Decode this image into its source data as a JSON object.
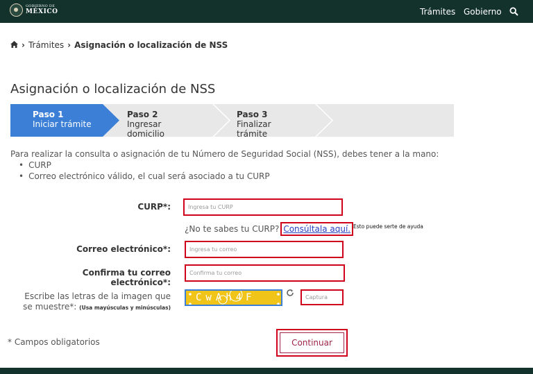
{
  "header": {
    "logo_small": "GOBIERNO DE",
    "logo_big": "MÉXICO",
    "nav_tramites": "Trámites",
    "nav_gobierno": "Gobierno",
    "search_icon": "search-icon"
  },
  "breadcrumb": {
    "home_icon": "home-icon",
    "tramites": "Trámites",
    "current": "Asignación o localización de NSS"
  },
  "page_title": "Asignación o localización de NSS",
  "steps": [
    {
      "title": "Paso 1",
      "subtitle": "Iniciar trámite",
      "active": true
    },
    {
      "title": "Paso 2",
      "subtitle": "Ingresar domicilio",
      "active": false
    },
    {
      "title": "Paso 3",
      "subtitle": "Finalizar trámite",
      "active": false
    }
  ],
  "intro": {
    "text": "Para realizar la consulta o asignación de tu Número de Seguridad Social (NSS), debes tener a la mano:",
    "items": [
      "CURP",
      "Correo electrónico válido, el cual será asociado a tu CURP"
    ]
  },
  "form": {
    "curp_label": "CURP*:",
    "curp_placeholder": "Ingresa tu CURP",
    "curp_hint": "¿No te sabes tu CURP?",
    "curp_link": "Consúltala aquí.",
    "help_text": "Esto puede serte de ayuda",
    "email_label": "Correo electrónico*:",
    "email_placeholder": "Ingresa tu correo",
    "confirm_label": "Confirma tu correo electrónico*:",
    "confirm_placeholder": "Confirma tu correo",
    "captcha_label": "Escribe las letras de la imagen que se muestre*:",
    "captcha_note": "(Usa mayúsculas y minúsculas)",
    "captcha_text": "CwAh4F",
    "captcha_placeholder": "Captura",
    "refresh_icon": "refresh-icon",
    "required_note": "* Campos obligatorios",
    "submit_label": "Continuar"
  },
  "colors": {
    "header_bg": "#13322b",
    "step_active": "#3b7fd6",
    "highlight": "#d0021b",
    "brand": "#9d2449"
  }
}
